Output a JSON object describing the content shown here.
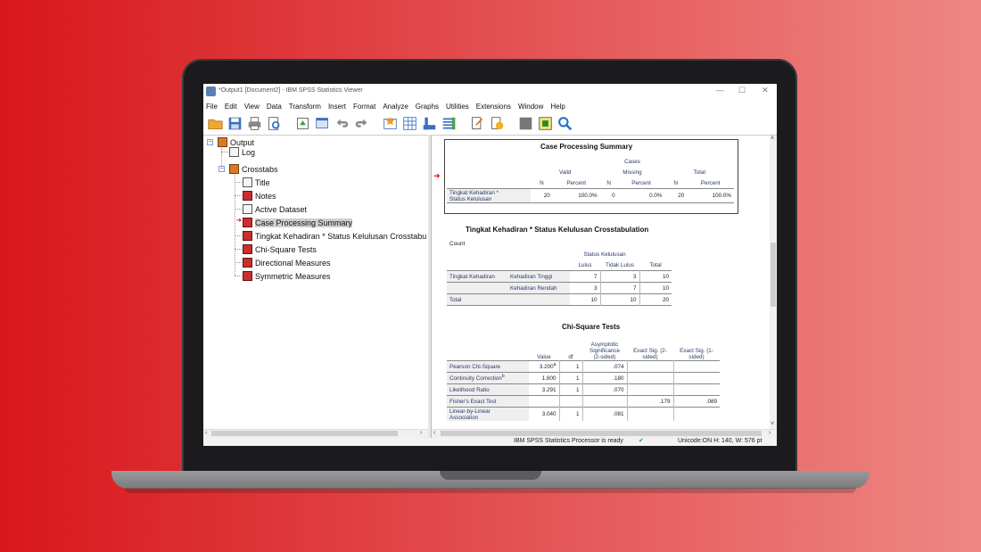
{
  "window": {
    "title": "*Output1 [Document2] - IBM SPSS Statistics Viewer",
    "minimize": "—",
    "maximize": "☐",
    "close": "✕"
  },
  "menu": [
    "File",
    "Edit",
    "View",
    "Data",
    "Transform",
    "Insert",
    "Format",
    "Analyze",
    "Graphs",
    "Utilities",
    "Extensions",
    "Window",
    "Help"
  ],
  "toolbar_icons": [
    "open-folder-icon",
    "save-icon",
    "print-icon",
    "print-preview-icon",
    "export-icon",
    "recall-dialog-icon",
    "undo-icon",
    "redo-icon",
    "goto-data-icon",
    "goto-variable-icon",
    "variables-icon",
    "designate-window-icon",
    "promote-icon",
    "demote-icon",
    "collapse-icon",
    "show-icon",
    "search-icon"
  ],
  "tree": {
    "root": "Output",
    "log": "Log",
    "crosstabs": "Crosstabs",
    "children": [
      "Title",
      "Notes",
      "Active Dataset",
      "Case Processing Summary",
      "Tingkat Kehadiran * Status Kelulusan Crosstabu",
      "Chi-Square Tests",
      "Directional Measures",
      "Symmetric Measures"
    ],
    "selected_index": 3
  },
  "case_processing": {
    "title": "Case Processing Summary",
    "cases_header": "Cases",
    "groups": [
      "Valid",
      "Missing",
      "Total"
    ],
    "subheaders": [
      "N",
      "Percent",
      "N",
      "Percent",
      "N",
      "Percent"
    ],
    "row_label_1": "Tingkat Kehadiran *",
    "row_label_2": "Status Kelulusan",
    "values": [
      "20",
      "100.0%",
      "0",
      "0.0%",
      "20",
      "100.0%"
    ]
  },
  "crosstab": {
    "title": "Tingkat Kehadiran * Status Kelulusan Crosstabulation",
    "count_label": "Count",
    "col_group": "Status Kelulusan",
    "columns": [
      "Lulus",
      "Tidak Lulus",
      "Total"
    ],
    "row_var": "Tingkat Kehadiran",
    "rows": [
      {
        "label": "Kehadiran Tinggi",
        "values": [
          "7",
          "3",
          "10"
        ]
      },
      {
        "label": "Kehadiran Rendah",
        "values": [
          "3",
          "7",
          "10"
        ]
      }
    ],
    "total_label": "Total",
    "total_values": [
      "10",
      "10",
      "20"
    ]
  },
  "chisq": {
    "title": "Chi-Square Tests",
    "headers": [
      "Value",
      "df",
      "Asymptotic Significance (2-sided)",
      "Exact Sig. (2-sided)",
      "Exact Sig. (1-sided)"
    ],
    "asym_lines": [
      "Asymptotic",
      "Significance",
      "(2-sided)"
    ],
    "exact2_lines": [
      "Exact Sig. (2-",
      "sided)"
    ],
    "exact1_lines": [
      "Exact Sig. (1-",
      "sided)"
    ],
    "rows": [
      {
        "label": "Pearson Chi-Square",
        "sup": "a",
        "value": "3.200",
        "df": "1",
        "asym": ".074",
        "ex2": "",
        "ex1": ""
      },
      {
        "label": "Continuity Correction",
        "sup": "b",
        "value": "1.800",
        "df": "1",
        "asym": ".180",
        "ex2": "",
        "ex1": ""
      },
      {
        "label": "Likelihood Ratio",
        "sup": "",
        "value": "3.291",
        "df": "1",
        "asym": ".070",
        "ex2": "",
        "ex1": ""
      },
      {
        "label": "Fisher's Exact Test",
        "sup": "",
        "value": "",
        "df": "",
        "asym": "",
        "ex2": ".179",
        "ex1": ".089"
      },
      {
        "label": "Linear-by-Linear Association",
        "sup": "",
        "value": "3.040",
        "df": "1",
        "asym": ".081",
        "ex2": "",
        "ex1": ""
      }
    ],
    "lbl_line1": "Linear-by-Linear",
    "lbl_line2": "Association"
  },
  "status": {
    "processor": "IBM SPSS Statistics Processor is ready",
    "unicode": "Unicode:ON  H: 140, W: 576 pt"
  },
  "colors": {
    "background_left": "#d8171b",
    "background_right": "#ee8784",
    "selection_arrow": "#e00000"
  }
}
